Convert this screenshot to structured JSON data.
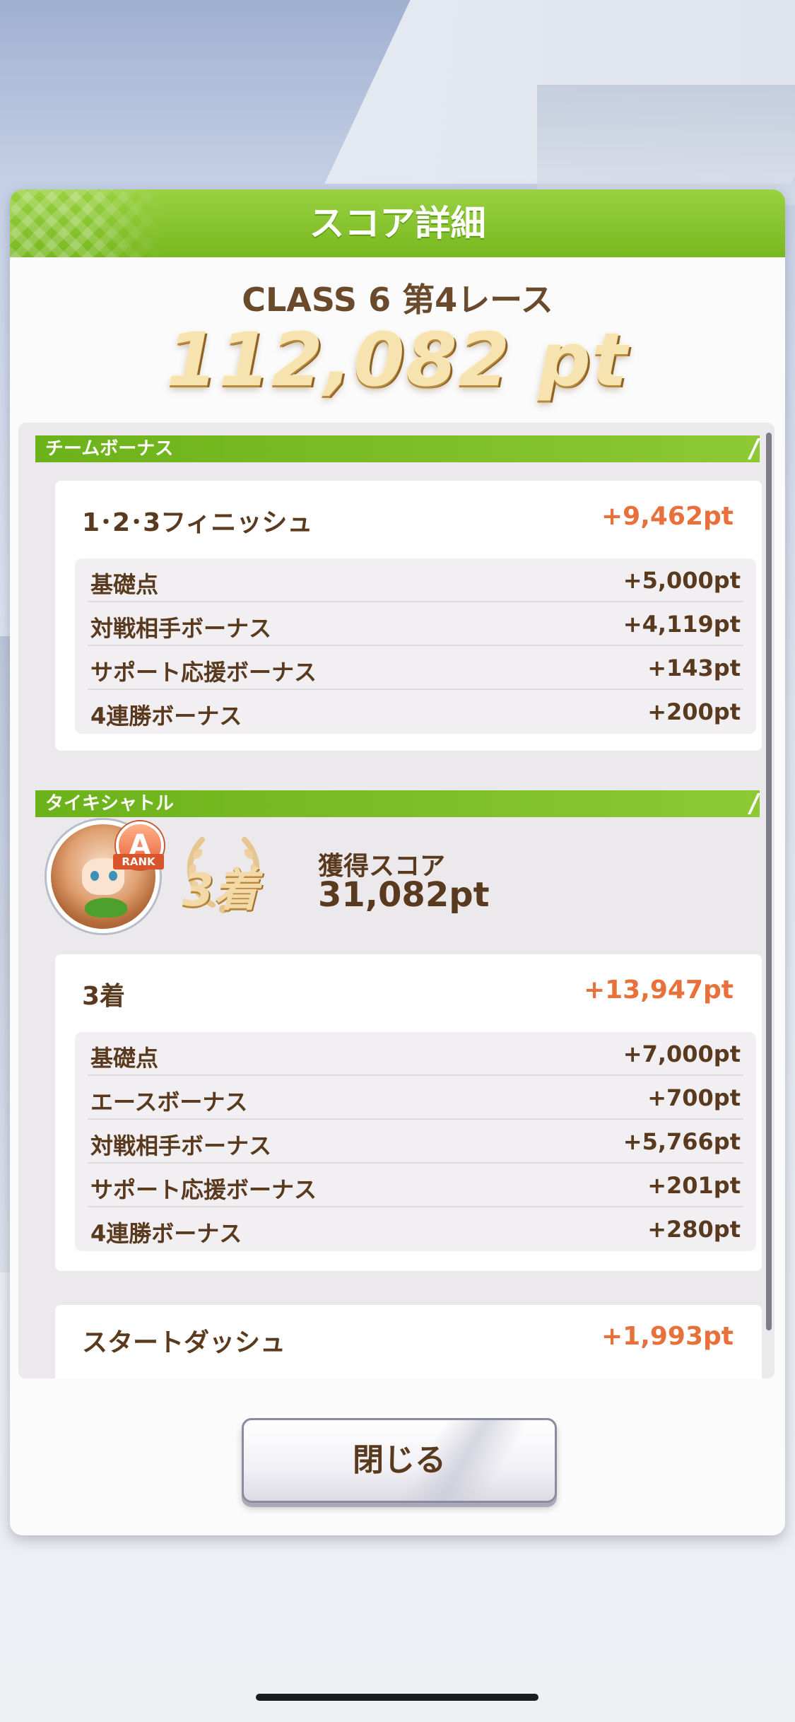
{
  "dialog": {
    "title": "スコア詳細",
    "race_name": "CLASS 6 第4レース",
    "total_score": "112,082 pt"
  },
  "team_bonus": {
    "section_title": "チームボーナス",
    "card_title": "1･2･3フィニッシュ",
    "card_value": "+9,462pt",
    "rows": [
      {
        "label": "基礎点",
        "value": "+5,000pt"
      },
      {
        "label": "対戦相手ボーナス",
        "value": "+4,119pt"
      },
      {
        "label": "サポート応援ボーナス",
        "value": "+143pt"
      },
      {
        "label": "4連勝ボーナス",
        "value": "+200pt"
      }
    ]
  },
  "character": {
    "section_title": "タイキシャトル",
    "rank_letter": "A",
    "rank_label": "RANK",
    "placement": "3着",
    "acquired_label": "獲得スコア",
    "acquired_value": "31,082pt",
    "placement_card": {
      "title": "3着",
      "value": "+13,947pt",
      "rows": [
        {
          "label": "基礎点",
          "value": "+7,000pt"
        },
        {
          "label": "エースボーナス",
          "value": "+700pt"
        },
        {
          "label": "対戦相手ボーナス",
          "value": "+5,766pt"
        },
        {
          "label": "サポート応援ボーナス",
          "value": "+201pt"
        },
        {
          "label": "4連勝ボーナス",
          "value": "+280pt"
        }
      ]
    },
    "start_dash": {
      "title": "スタートダッシュ",
      "value": "+1,993pt"
    }
  },
  "buttons": {
    "close_label": "閉じる"
  },
  "colors": {
    "header_green": "#77b81f",
    "section_green": "#6cb21a",
    "text_brown": "#5a3a1e",
    "points_orange": "#e8703a"
  }
}
